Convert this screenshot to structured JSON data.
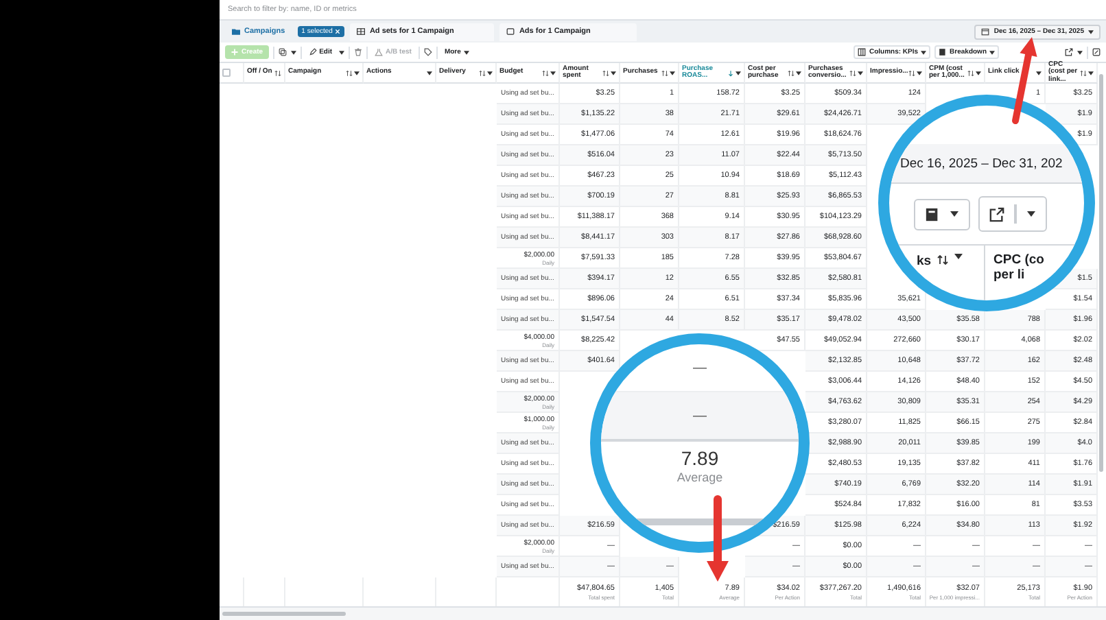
{
  "search": {
    "placeholder": "Search to filter by: name, ID or metrics"
  },
  "tabs": [
    {
      "label": "Campaigns",
      "selected": true
    },
    {
      "label": "Ad sets for 1 Campaign",
      "selected": false
    },
    {
      "label": "Ads for 1 Campaign",
      "selected": false
    }
  ],
  "selection_chip": {
    "label": "1 selected"
  },
  "date_range": {
    "label": "Dec 16, 2025 – Dec 31, 2025"
  },
  "toolbar": {
    "create": {
      "label": "Create",
      "disabled": true
    },
    "edit": {
      "label": "Edit"
    },
    "ab_test": {
      "label": "A/B test",
      "disabled": true
    },
    "more": {
      "label": "More"
    },
    "columns": {
      "label": "Columns: KPIs"
    },
    "breakdown": {
      "label": "Breakdown"
    }
  },
  "table": {
    "columns": [
      {
        "kind": "checkbox",
        "checked": false
      },
      {
        "kind": "text",
        "label": "Off / On",
        "sortable": true,
        "sorted": false,
        "menu": false
      },
      {
        "kind": "text",
        "label": "Campaign",
        "sortable": true,
        "sorted": false,
        "menu": true
      },
      {
        "kind": "text",
        "label": "Actions",
        "sortable": false,
        "sorted": false,
        "menu": true
      },
      {
        "kind": "text",
        "label": "Delivery",
        "sortable": true,
        "sorted": false,
        "menu": true
      },
      {
        "kind": "text",
        "label": "Budget",
        "sortable": true,
        "sorted": false,
        "menu": true
      },
      {
        "kind": "text",
        "label": "Amount spent",
        "sortable": true,
        "sorted": false,
        "menu": true
      },
      {
        "kind": "text",
        "label": "Purchases",
        "sortable": true,
        "sorted": false,
        "menu": true
      },
      {
        "kind": "text",
        "label": "Purchase ROAS...",
        "sortable": true,
        "sorted": true,
        "menu": true
      },
      {
        "kind": "text",
        "label": "Cost per purchase",
        "sortable": true,
        "sorted": false,
        "menu": true
      },
      {
        "kind": "text",
        "label": "Purchases conversio...",
        "sortable": true,
        "sorted": false,
        "menu": true
      },
      {
        "kind": "text",
        "label": "Impressio...",
        "sortable": true,
        "sorted": false,
        "menu": true
      },
      {
        "kind": "text",
        "label": "CPM (cost per 1,000...",
        "sortable": true,
        "sorted": false,
        "menu": true
      },
      {
        "kind": "text",
        "label": "Link click",
        "sortable": false,
        "sorted": false,
        "menu": true
      },
      {
        "kind": "text",
        "label": "CPC (cost per link...",
        "sortable": true,
        "sorted": false,
        "menu": true
      }
    ],
    "rows": [
      {
        "budget": {
          "kind": "adset",
          "text": "Using ad set bu..."
        },
        "cells": [
          "$3.25",
          "1",
          "158.72",
          "$3.25",
          "$509.34",
          "124",
          null,
          "1",
          "$3.25"
        ]
      },
      {
        "budget": {
          "kind": "adset",
          "text": "Using ad set bu..."
        },
        "cells": [
          "$1,135.22",
          "38",
          "21.71",
          "$29.61",
          "$24,426.71",
          "39,522",
          null,
          null,
          "$1.9"
        ]
      },
      {
        "budget": {
          "kind": "adset",
          "text": "Using ad set bu..."
        },
        "cells": [
          "$1,477.06",
          "74",
          "12.61",
          "$19.96",
          "$18,624.76",
          null,
          null,
          null,
          "$1.9"
        ]
      },
      {
        "budget": {
          "kind": "adset",
          "text": "Using ad set bu..."
        },
        "cells": [
          "$516.04",
          "23",
          "11.07",
          "$22.44",
          "$5,713.50",
          null,
          null,
          null,
          null
        ]
      },
      {
        "budget": {
          "kind": "adset",
          "text": "Using ad set bu..."
        },
        "cells": [
          "$467.23",
          "25",
          "10.94",
          "$18.69",
          "$5,112.43",
          null,
          null,
          null,
          null
        ]
      },
      {
        "budget": {
          "kind": "adset",
          "text": "Using ad set bu..."
        },
        "cells": [
          "$700.19",
          "27",
          "8.81",
          "$25.93",
          "$6,865.53",
          null,
          null,
          null,
          null
        ]
      },
      {
        "budget": {
          "kind": "adset",
          "text": "Using ad set bu..."
        },
        "cells": [
          "$11,388.17",
          "368",
          "9.14",
          "$30.95",
          "$104,123.29",
          null,
          null,
          null,
          null
        ]
      },
      {
        "budget": {
          "kind": "adset",
          "text": "Using ad set bu..."
        },
        "cells": [
          "$8,441.17",
          "303",
          "8.17",
          "$27.86",
          "$68,928.60",
          null,
          null,
          null,
          null
        ]
      },
      {
        "budget": {
          "kind": "daily",
          "text": "$2,000.00",
          "period": "Daily"
        },
        "cells": [
          "$7,591.33",
          "185",
          "7.28",
          "$39.95",
          "$53,804.67",
          null,
          null,
          null,
          null
        ]
      },
      {
        "budget": {
          "kind": "adset",
          "text": "Using ad set bu..."
        },
        "cells": [
          "$394.17",
          "12",
          "6.55",
          "$32.85",
          "$2,580.81",
          null,
          null,
          null,
          "$1.5"
        ]
      },
      {
        "budget": {
          "kind": "adset",
          "text": "Using ad set bu..."
        },
        "cells": [
          "$896.06",
          "24",
          "6.51",
          "$37.34",
          "$5,835.96",
          "35,621",
          null,
          null,
          "$1.54"
        ]
      },
      {
        "budget": {
          "kind": "adset",
          "text": "Using ad set bu..."
        },
        "cells": [
          "$1,547.54",
          "44",
          "8.52",
          "$35.17",
          "$9,478.02",
          "43,500",
          "$35.58",
          "788",
          "$1.96"
        ]
      },
      {
        "budget": {
          "kind": "daily",
          "text": "$4,000.00",
          "period": "Daily"
        },
        "cells": [
          "$8,225.42",
          null,
          null,
          "$47.55",
          "$49,052.94",
          "272,660",
          "$30.17",
          "4,068",
          "$2.02"
        ]
      },
      {
        "budget": {
          "kind": "adset",
          "text": "Using ad set bu..."
        },
        "cells": [
          "$401.64",
          null,
          null,
          null,
          "$2,132.85",
          "10,648",
          "$37.72",
          "162",
          "$2.48"
        ]
      },
      {
        "budget": {
          "kind": "adset",
          "text": "Using ad set bu..."
        },
        "cells": [
          null,
          null,
          null,
          null,
          "$3,006.44",
          "14,126",
          "$48.40",
          "152",
          "$4.50"
        ]
      },
      {
        "budget": {
          "kind": "daily",
          "text": "$2,000.00",
          "period": "Daily"
        },
        "cells": [
          null,
          null,
          null,
          null,
          "$4,763.62",
          "30,809",
          "$35.31",
          "254",
          "$4.29"
        ]
      },
      {
        "budget": {
          "kind": "daily",
          "text": "$1,000.00",
          "period": "Daily"
        },
        "cells": [
          null,
          null,
          null,
          null,
          "$3,280.07",
          "11,825",
          "$66.15",
          "275",
          "$2.84"
        ]
      },
      {
        "budget": {
          "kind": "adset",
          "text": "Using ad set bu..."
        },
        "cells": [
          null,
          null,
          null,
          null,
          "$2,988.90",
          "20,011",
          "$39.85",
          "199",
          "$4.0"
        ]
      },
      {
        "budget": {
          "kind": "adset",
          "text": "Using ad set bu..."
        },
        "cells": [
          null,
          null,
          null,
          null,
          "$2,480.53",
          "19,135",
          "$37.82",
          "411",
          "$1.76"
        ]
      },
      {
        "budget": {
          "kind": "adset",
          "text": "Using ad set bu..."
        },
        "cells": [
          null,
          null,
          null,
          null,
          "$740.19",
          "6,769",
          "$32.20",
          "114",
          "$1.91"
        ]
      },
      {
        "budget": {
          "kind": "adset",
          "text": "Using ad set bu..."
        },
        "cells": [
          null,
          null,
          null,
          null,
          "$524.84",
          "17,832",
          "$16.00",
          "81",
          "$3.53"
        ]
      },
      {
        "budget": {
          "kind": "adset",
          "text": "Using ad set bu..."
        },
        "cells": [
          "$216.59",
          null,
          null,
          "$216.59",
          "$125.98",
          "6,224",
          "$34.80",
          "113",
          "$1.92"
        ]
      },
      {
        "budget": {
          "kind": "daily",
          "text": "$2,000.00",
          "period": "Daily"
        },
        "cells": [
          "—",
          null,
          null,
          "—",
          "$0.00",
          "—",
          "—",
          "—",
          "—"
        ]
      },
      {
        "budget": {
          "kind": "adset",
          "text": "Using ad set bu..."
        },
        "cells": [
          "—",
          "—",
          null,
          "—",
          "$0.00",
          "—",
          "—",
          "—",
          "—"
        ]
      }
    ],
    "totals": [
      {
        "value": "$47,804.65",
        "caption": "Total spent"
      },
      {
        "value": "1,405",
        "caption": "Total"
      },
      {
        "value": "7.89",
        "caption": "Average"
      },
      {
        "value": "$34.02",
        "caption": "Per Action"
      },
      {
        "value": "$377,267.20",
        "caption": "Total"
      },
      {
        "value": "1,490,616",
        "caption": "Total"
      },
      {
        "value": "$32.07",
        "caption": "Per 1,000 impressi..."
      },
      {
        "value": "25,173",
        "caption": "Total"
      },
      {
        "value": "$1.90",
        "caption": "Per Action"
      }
    ]
  },
  "annotations": {
    "date_lens": {
      "date": "Dec 16, 2025 – Dec 31, 202",
      "left_header": "ks",
      "right_header": "CPC (co",
      "right_header_line": "per li"
    },
    "average_lens": {
      "dashes": [
        "—",
        "—"
      ],
      "value": "7.89",
      "caption": "Average"
    }
  }
}
